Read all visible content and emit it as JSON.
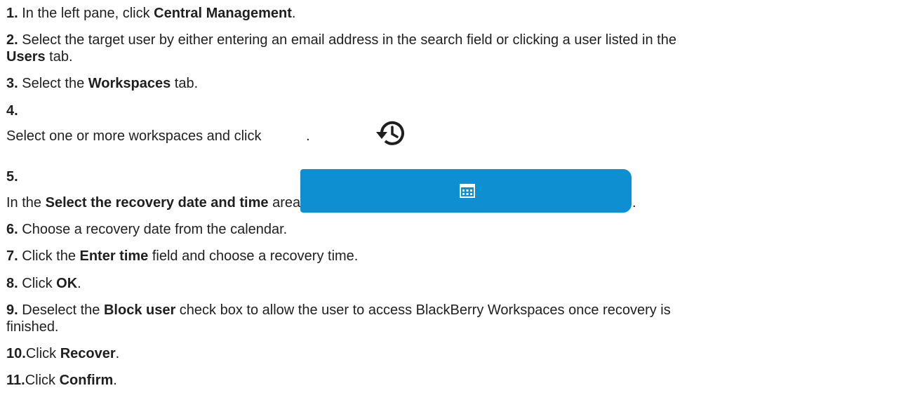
{
  "steps": [
    {
      "number": "1.",
      "parts": [
        "In the left pane, click ",
        "Central Management",
        "."
      ]
    },
    {
      "number": "2.",
      "parts": [
        "Select the target user by either entering an email address in the search field or clicking a user listed in the",
        "Users",
        " tab."
      ]
    },
    {
      "number": "3.",
      "parts": [
        "Select the ",
        "Workspaces",
        " tab."
      ]
    },
    {
      "number": "4.",
      "parts": [
        "Select one or more workspaces and click ",
        "."
      ]
    },
    {
      "number": "5.",
      "parts": [
        "In the ",
        "Select the recovery date and time",
        " area, click ",
        "."
      ]
    },
    {
      "number": "6.",
      "parts": [
        "Choose a recovery date from the calendar."
      ]
    },
    {
      "number": "7.",
      "parts": [
        "Click the ",
        "Enter time",
        " field and choose a recovery time."
      ]
    },
    {
      "number": "8.",
      "parts": [
        "Click ",
        "OK",
        "."
      ]
    },
    {
      "number": "9.",
      "parts": [
        "Deselect the ",
        "Block user",
        " check box to allow the user to access BlackBerry Workspaces once recovery is",
        "finished."
      ]
    },
    {
      "number": "10.",
      "parts": [
        "Click ",
        "Recover",
        "."
      ]
    },
    {
      "number": "11.",
      "parts": [
        "Click ",
        "Confirm",
        "."
      ]
    }
  ],
  "icons": {
    "recover": "history-recover-icon",
    "calendar": "calendar-icon"
  },
  "colors": {
    "calendar_button": "#0e8fd1",
    "text": "#1f1f1f"
  }
}
